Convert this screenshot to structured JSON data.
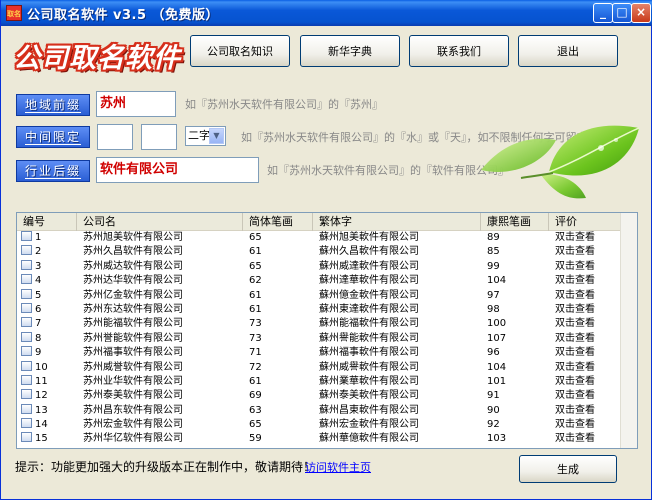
{
  "window": {
    "title": "公司取名软件 v3.5 （免费版）",
    "app_icon_text": "取名",
    "minimize": "_",
    "maximize": "□",
    "close": "×"
  },
  "logo": "公司取名软件",
  "top_buttons": [
    "公司取名知识",
    "新华字典",
    "联系我们",
    "退出"
  ],
  "form": {
    "prefix": {
      "label": "地域前缀",
      "value": "苏州",
      "hint": "如『苏州水天软件有限公司』的『苏州』"
    },
    "middle": {
      "label": "中间限定",
      "value1": "",
      "value2": "",
      "select": "二字",
      "hint": "如『苏州水天软件有限公司』的『水』或『天』，如不限制任何字可留空"
    },
    "suffix": {
      "label": "行业后缀",
      "value": "软件有限公司",
      "hint": "如『苏州水天软件有限公司』的『软件有限公司』"
    }
  },
  "table": {
    "columns": [
      "编号",
      "公司名",
      "简体笔画",
      "繁体字",
      "康熙笔画",
      "评价"
    ],
    "rows": [
      [
        "1",
        "苏州旭美软件有限公司",
        "65",
        "蘇州旭美軟件有限公司",
        "89",
        "双击查看"
      ],
      [
        "2",
        "苏州久昌软件有限公司",
        "61",
        "蘇州久昌軟件有限公司",
        "85",
        "双击查看"
      ],
      [
        "3",
        "苏州威达软件有限公司",
        "65",
        "蘇州威達軟件有限公司",
        "99",
        "双击查看"
      ],
      [
        "4",
        "苏州达华软件有限公司",
        "62",
        "蘇州達華軟件有限公司",
        "104",
        "双击查看"
      ],
      [
        "5",
        "苏州亿金软件有限公司",
        "61",
        "蘇州億金軟件有限公司",
        "97",
        "双击查看"
      ],
      [
        "6",
        "苏州东达软件有限公司",
        "61",
        "蘇州東達軟件有限公司",
        "98",
        "双击查看"
      ],
      [
        "7",
        "苏州能福软件有限公司",
        "73",
        "蘇州能福軟件有限公司",
        "100",
        "双击查看"
      ],
      [
        "8",
        "苏州誉能软件有限公司",
        "73",
        "蘇州譽能軟件有限公司",
        "107",
        "双击查看"
      ],
      [
        "9",
        "苏州福事软件有限公司",
        "71",
        "蘇州福事軟件有限公司",
        "96",
        "双击查看"
      ],
      [
        "10",
        "苏州威誉软件有限公司",
        "72",
        "蘇州威譽軟件有限公司",
        "104",
        "双击查看"
      ],
      [
        "11",
        "苏州业华软件有限公司",
        "61",
        "蘇州業華軟件有限公司",
        "101",
        "双击查看"
      ],
      [
        "12",
        "苏州泰美软件有限公司",
        "69",
        "蘇州泰美軟件有限公司",
        "91",
        "双击查看"
      ],
      [
        "13",
        "苏州昌东软件有限公司",
        "63",
        "蘇州昌東軟件有限公司",
        "90",
        "双击查看"
      ],
      [
        "14",
        "苏州宏金软件有限公司",
        "65",
        "蘇州宏金軟件有限公司",
        "92",
        "双击查看"
      ],
      [
        "15",
        "苏州华亿软件有限公司",
        "59",
        "蘇州華億軟件有限公司",
        "103",
        "双击查看"
      ]
    ]
  },
  "footer": {
    "tip": "提示：功能更加强大的升级版本正在制作中，敬请期待！",
    "link": "访问软件主页",
    "generate": "生成"
  },
  "colors": {
    "title_bar": "#0a58d8",
    "label_button": "#2a5ed4",
    "input_text": "#d00000",
    "link": "#0000ff"
  }
}
